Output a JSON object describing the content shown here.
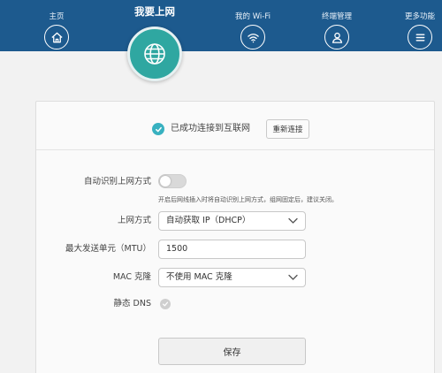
{
  "nav": {
    "home_label": "主页",
    "internet_label": "我要上网",
    "wifi_label": "我的 Wi-Fi",
    "devices_label": "终端管理",
    "more_label": "更多功能"
  },
  "status": {
    "text": "已成功连接到互联网",
    "reconnect_label": "重新连接"
  },
  "form": {
    "auto_detect_label": "自动识别上网方式",
    "auto_detect_enabled": false,
    "auto_detect_hint": "开启后网线插入时将自动识别上网方式，组网固定后，建议关闭。",
    "connection_type_label": "上网方式",
    "connection_type_value": "自动获取 IP（DHCP）",
    "mtu_label": "最大发送单元（MTU）",
    "mtu_value": "1500",
    "mac_clone_label": "MAC 克隆",
    "mac_clone_value": "不使用 MAC 克隆",
    "static_dns_label": "静态 DNS",
    "save_label": "保存"
  },
  "colors": {
    "topbar": "#1d5a8e",
    "accent": "#2fa7a1",
    "status_check": "#38b1c0"
  }
}
